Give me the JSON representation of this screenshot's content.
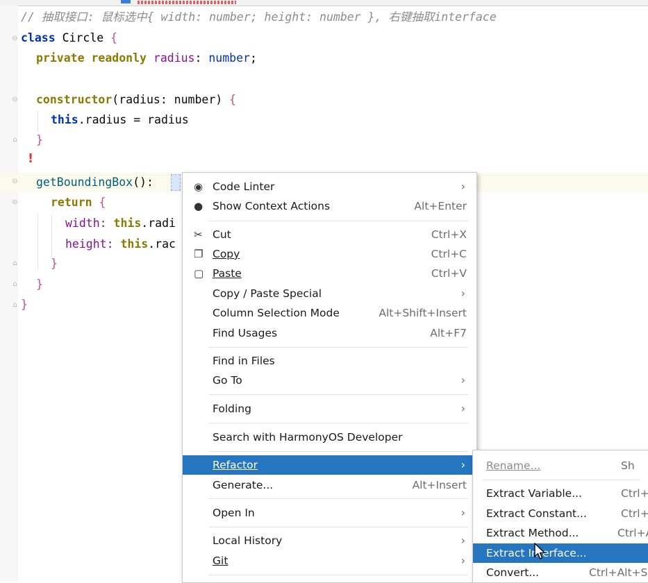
{
  "editor": {
    "lines": {
      "comment": "// 抽取接口: 鼠标选中{ width: number; height: number }, 右键抽取interface",
      "class_kw": "class",
      "class_name": "Circle",
      "private_kw": "private readonly",
      "radius_prop": "radius",
      "number_type": "number",
      "constructor_kw": "constructor",
      "constructor_params": "(radius: number) ",
      "this_kw": "this",
      "assign": ".radius = radius",
      "method_name": "getBoundingBox",
      "method_sig": "(): ",
      "return_kw": "return",
      "width_line": "width: ",
      "width_rest": ".radi",
      "height_line": "height: ",
      "height_rest": ".rac",
      "open_brace": "{",
      "close_brace": "}",
      "semi": ";",
      "colon": ": "
    },
    "error_icon": "error-bulb-icon"
  },
  "context_menu": {
    "items": [
      {
        "icon": "code-linter-icon",
        "label": "Code Linter",
        "submenu": true
      },
      {
        "icon": "bulb-icon",
        "label": "Show Context Actions",
        "shortcut": "Alt+Enter"
      },
      {
        "icon": "scissors-icon",
        "label": "Cut",
        "shortcut": "Ctrl+X"
      },
      {
        "icon": "copy-icon",
        "label": "Copy",
        "shortcut": "Ctrl+C"
      },
      {
        "icon": "paste-icon",
        "label": "Paste",
        "shortcut": "Ctrl+V"
      },
      {
        "label": "Copy / Paste Special",
        "submenu": true
      },
      {
        "label": "Column Selection Mode",
        "shortcut": "Alt+Shift+Insert"
      },
      {
        "label": "Find Usages",
        "shortcut": "Alt+F7"
      },
      {
        "label": "Find in Files"
      },
      {
        "label": "Go To",
        "submenu": true
      },
      {
        "label": "Folding",
        "submenu": true
      },
      {
        "label": "Search with HarmonyOS Developer"
      },
      {
        "label": "Refactor",
        "submenu": true,
        "selected": true
      },
      {
        "label": "Generate...",
        "shortcut": "Alt+Insert"
      },
      {
        "label": "Open In",
        "submenu": true
      },
      {
        "label": "Local History",
        "submenu": true
      },
      {
        "label": "Git",
        "submenu": true
      }
    ]
  },
  "refactor_submenu": {
    "items": [
      {
        "label": "Rename...",
        "shortcut": "Sh",
        "disabled": true
      },
      {
        "label": "Extract Variable...",
        "shortcut": "Ctrl+"
      },
      {
        "label": "Extract Constant...",
        "shortcut": "Ctrl+"
      },
      {
        "label": "Extract Method...",
        "shortcut": "Ctrl+A"
      },
      {
        "label": "Extract Interface...",
        "selected": true
      },
      {
        "label": "Convert...",
        "shortcut": "Ctrl+Alt+S"
      }
    ]
  },
  "colors": {
    "selection": "#2675bf",
    "keyword": "#0033b3",
    "brace": "#c94e80",
    "function": "#00627a"
  }
}
